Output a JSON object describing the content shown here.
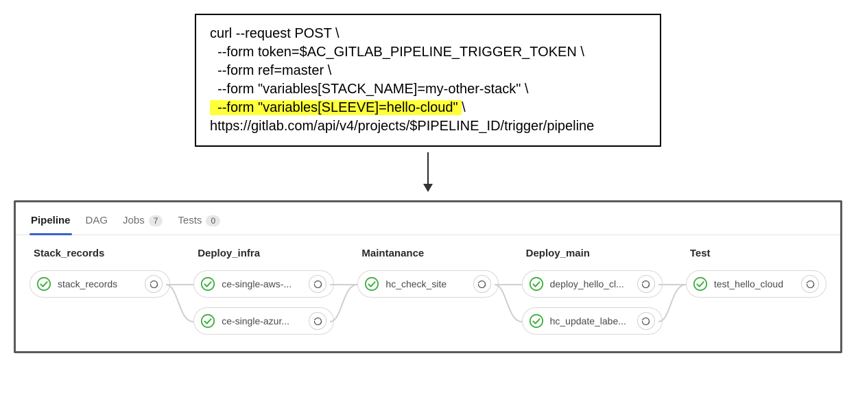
{
  "code": {
    "l1": "curl --request POST \\",
    "l2": "  --form token=$AC_GITLAB_PIPELINE_TRIGGER_TOKEN \\",
    "l3": "  --form ref=master \\",
    "l4": "  --form \"variables[STACK_NAME]=my-other-stack\" \\",
    "l5_hl": "  --form \"variables[SLEEVE]=hello-cloud\" ",
    "l5_tail": "\\",
    "l6": "https://gitlab.com/api/v4/projects/$PIPELINE_ID/trigger/pipeline"
  },
  "tabs": {
    "pipeline": "Pipeline",
    "dag": "DAG",
    "jobs": "Jobs",
    "jobs_count": "7",
    "tests": "Tests",
    "tests_count": "0"
  },
  "stages": {
    "s1": {
      "title": "Stack_records",
      "j1": "stack_records"
    },
    "s2": {
      "title": "Deploy_infra",
      "j1": "ce-single-aws-...",
      "j2": "ce-single-azur..."
    },
    "s3": {
      "title": "Maintanance",
      "j1": "hc_check_site"
    },
    "s4": {
      "title": "Deploy_main",
      "j1": "deploy_hello_cl...",
      "j2": "hc_update_labe..."
    },
    "s5": {
      "title": "Test",
      "j1": "test_hello_cloud"
    }
  }
}
